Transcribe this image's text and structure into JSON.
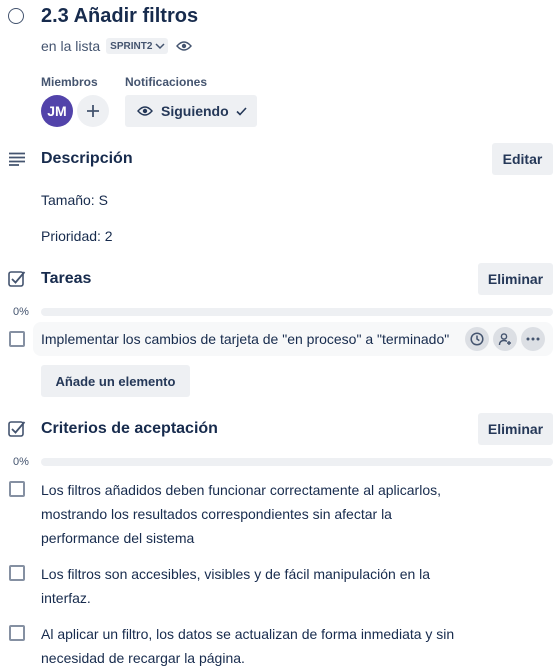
{
  "card": {
    "title": "2.3 Añadir filtros",
    "list_prefix": "en la lista",
    "list_name": "SPRINT2"
  },
  "members": {
    "label": "Miembros",
    "avatar_initials": "JM",
    "avatar_color": "#5243aa"
  },
  "notifications": {
    "label": "Notificaciones",
    "button_label": "Siguiendo"
  },
  "description": {
    "title": "Descripción",
    "edit_label": "Editar",
    "lines": [
      "Tamaño: S",
      "Prioridad: 2"
    ]
  },
  "tasks": {
    "title": "Tareas",
    "delete_label": "Eliminar",
    "progress_text": "0%",
    "progress": 0,
    "items": [
      "Implementar los cambios de tarjeta de \"en proceso\" a \"terminado\""
    ],
    "add_item_label": "Añade un elemento"
  },
  "criteria": {
    "title": "Criterios de aceptación",
    "delete_label": "Eliminar",
    "progress_text": "0%",
    "progress": 0,
    "items": [
      "Los filtros añadidos deben funcionar correctamente al aplicarlos, mostrando los resultados correspondientes sin afectar la performance del sistema",
      "Los filtros son accesibles, visibles y de fácil manipulación en la interfaz.",
      "Al aplicar un filtro, los datos se actualizan de forma inmediata y sin necesidad de recargar la página."
    ]
  }
}
